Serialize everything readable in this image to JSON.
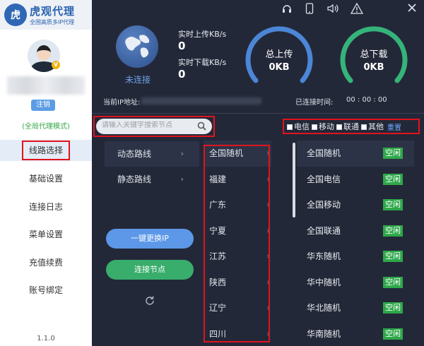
{
  "app": {
    "logo_badge": "虎",
    "title": "虎观代理",
    "subtitle": "全国高质多IP代理",
    "version": "1.1.0"
  },
  "user": {
    "vip_badge": "V",
    "logout_label": "注销",
    "mode_label": "(全局代理模式)"
  },
  "nav": {
    "items": [
      "线路选择",
      "基础设置",
      "连接日志",
      "菜单设置",
      "充值续费",
      "账号绑定"
    ],
    "active_index": 0
  },
  "status": {
    "connection": "未连接",
    "upload_rate_label": "实时上传KB/s",
    "upload_rate_value": "0",
    "download_rate_label": "实时下载KB/s",
    "download_rate_value": "0",
    "total_upload_label": "总上传",
    "total_upload_value": "0KB",
    "total_download_label": "总下载",
    "total_download_value": "0KB",
    "ip_label": "当前IP地址:",
    "connected_time_label": "已连接时间:",
    "connected_time_value": "00 : 00 : 00"
  },
  "search": {
    "placeholder": "请输入关键字搜索节点"
  },
  "filters": {
    "items": [
      "电信",
      "移动",
      "联通",
      "其他"
    ],
    "reset_label": "重置"
  },
  "routes": {
    "items": [
      "动态路线",
      "静态路线"
    ],
    "active_index": 0
  },
  "provinces": {
    "items": [
      "全国随机",
      "福建",
      "广东",
      "宁夏",
      "江苏",
      "陕西",
      "辽宁",
      "四川"
    ],
    "active_index": 0
  },
  "nodes": {
    "items": [
      {
        "name": "全国随机",
        "status": "空闲"
      },
      {
        "name": "全国电信",
        "status": "空闲"
      },
      {
        "name": "全国移动",
        "status": "空闲"
      },
      {
        "name": "全国联通",
        "status": "空闲"
      },
      {
        "name": "华东随机",
        "status": "空闲"
      },
      {
        "name": "华中随机",
        "status": "空闲"
      },
      {
        "name": "华北随机",
        "status": "空闲"
      },
      {
        "name": "华南随机",
        "status": "空闲"
      }
    ],
    "active_index": 0
  },
  "actions": {
    "switch_ip_label": "一键更换IP",
    "connect_label": "连接节点"
  },
  "colors": {
    "sidebar_bg": "#ffffff",
    "main_bg": "#232838",
    "accent_blue": "#5c97e8",
    "accent_green": "#38ad6c",
    "highlight_red": "#e0141e",
    "free_badge": "#2ea84a"
  },
  "icons": {
    "top_bar": [
      "headset-icon",
      "phone-icon",
      "volume-icon",
      "warning-icon",
      "close-icon"
    ]
  }
}
